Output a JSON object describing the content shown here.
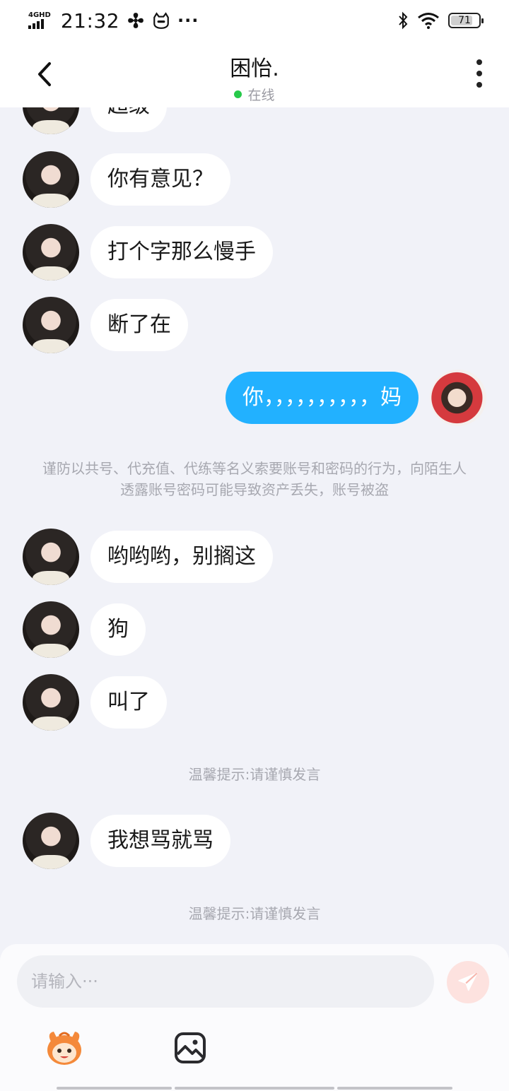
{
  "status_bar": {
    "network": "4GHD",
    "time": "21:32",
    "battery": "71",
    "battery_level": 0.71
  },
  "header": {
    "title": "困怡.",
    "status": "在线",
    "colors": {
      "online": "#27c94a"
    }
  },
  "chat": {
    "partial_top_message": "超级",
    "messages_group1": [
      {
        "sender": "other",
        "text": "你有意见？"
      },
      {
        "sender": "other",
        "text": "打个字那么慢手"
      },
      {
        "sender": "other",
        "text": "断了在"
      }
    ],
    "my_message": {
      "sender": "me",
      "text": "你，，，，，，，，，，妈"
    },
    "security_notice": "谨防以共号、代充值、代练等名义索要账号和密码的行为，向陌生人透露账号密码可能导致资产丢失，账号被盗",
    "messages_group2": [
      {
        "sender": "other",
        "text": "哟哟哟，别搁这"
      },
      {
        "sender": "other",
        "text": "狗"
      },
      {
        "sender": "other",
        "text": "叫了"
      }
    ],
    "tip_1": "温馨提示:请谨慎发言",
    "messages_group3": [
      {
        "sender": "other",
        "text": "我想骂就骂"
      }
    ],
    "tip_2": "温馨提示:请谨慎发言",
    "colors": {
      "my_bubble": "#22b1ff",
      "other_bubble": "#ffffff",
      "background": "#f1f2f8"
    }
  },
  "composer": {
    "placeholder": "请输入···",
    "value": "",
    "icons": [
      "emoji-mascot-icon",
      "image-icon",
      "send-icon"
    ]
  }
}
